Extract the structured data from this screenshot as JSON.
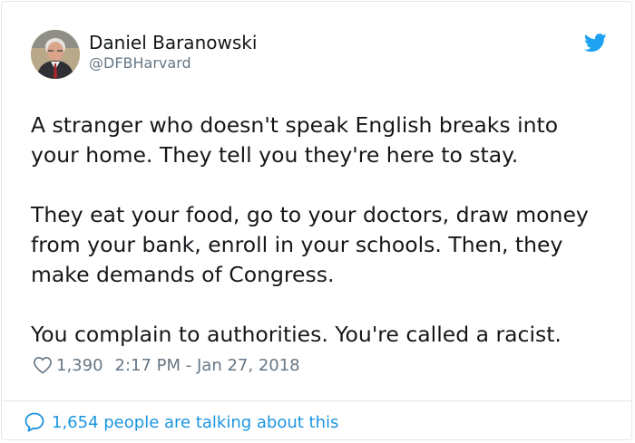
{
  "author": {
    "display_name": "Daniel Baranowski",
    "handle": "@DFBHarvard"
  },
  "tweet": {
    "paragraphs": [
      "A stranger who doesn't speak English breaks into\nyour home. They tell you they're here to stay.",
      "They eat your food, go to your doctors, draw money\nfrom your bank, enroll in your schools. Then, they\nmake demands of Congress.",
      "You complain to authorities. You're called a racist."
    ],
    "likes": "1,390",
    "timestamp": "2:17 PM - Jan 27, 2018"
  },
  "footer": {
    "conversation_label": "1,654 people are talking about this"
  },
  "icons": {
    "brand": "twitter-bird-icon",
    "like": "heart-icon",
    "conversation": "speech-bubble-icon"
  },
  "colors": {
    "twitter_blue": "#1da1f2",
    "link_blue": "#1b95e0",
    "secondary_text": "#657786",
    "border": "#e1e8ed"
  }
}
